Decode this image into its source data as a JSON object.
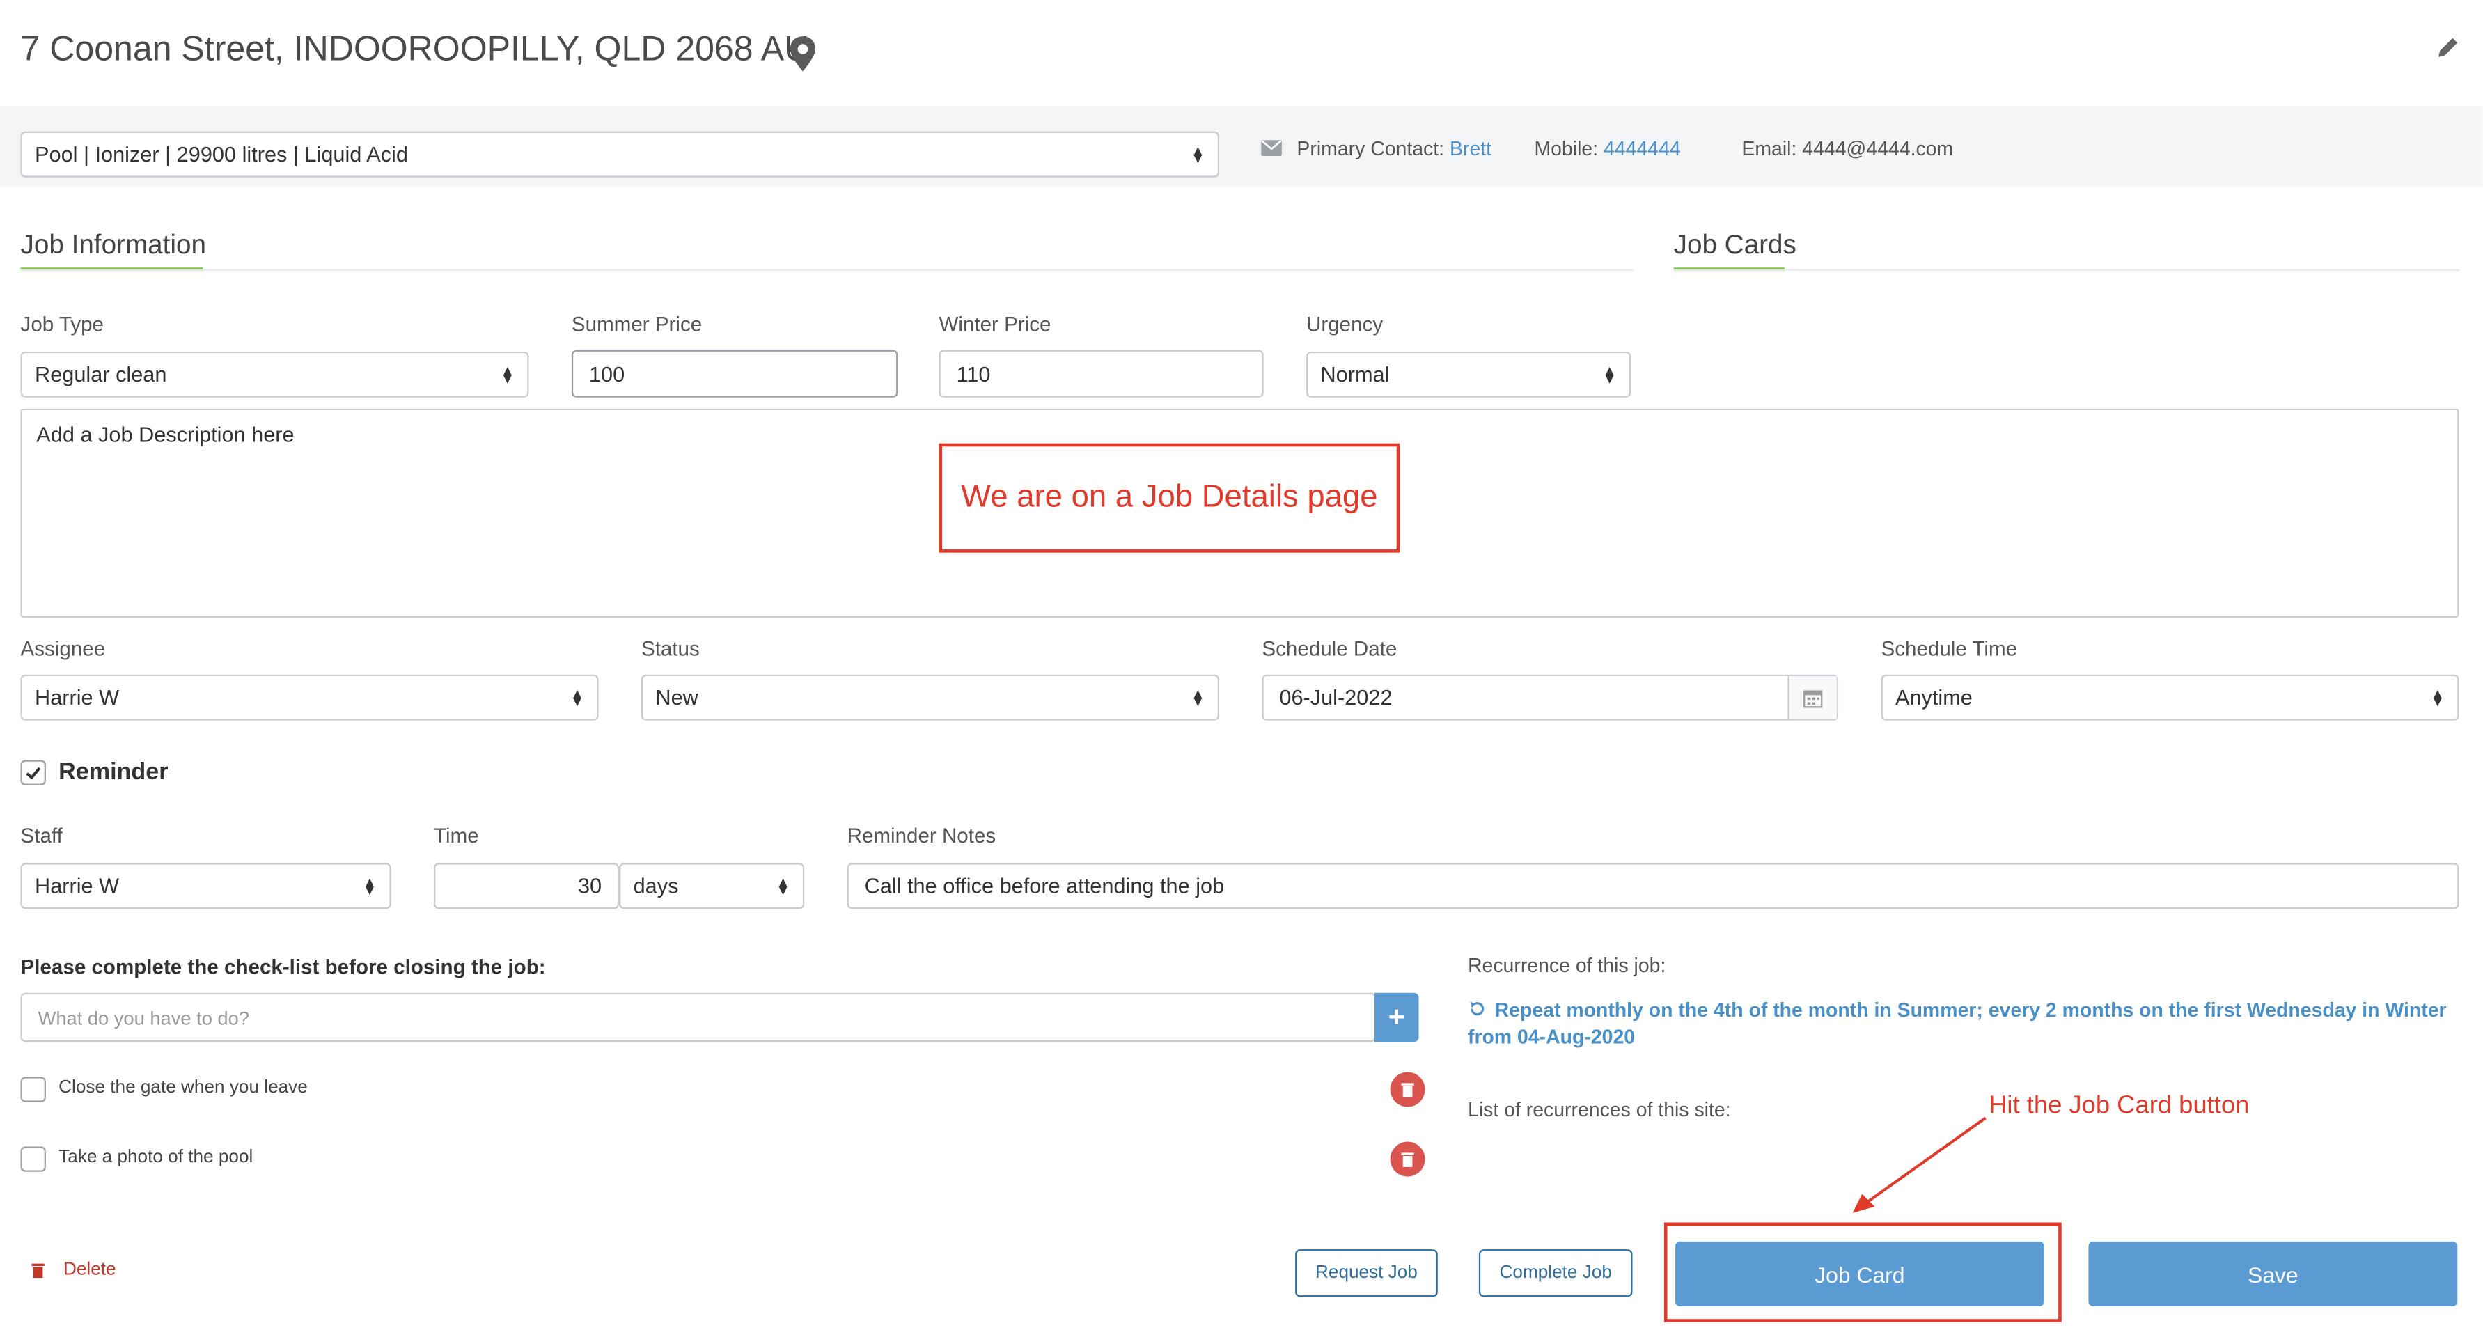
{
  "header": {
    "address": "7 Coonan Street, INDOOROOPILLY, QLD 2068 AU"
  },
  "contact_bar": {
    "pool_select": "Pool | Ionizer | 29900 litres | Liquid Acid",
    "primary_contact_label": "Primary Contact:",
    "primary_contact_value": "Brett",
    "mobile_label": "Mobile:",
    "mobile_value": "4444444",
    "email_label": "Email:",
    "email_value": "4444@4444.com"
  },
  "tabs": {
    "job_information": "Job Information",
    "job_cards": "Job Cards"
  },
  "job": {
    "job_type_label": "Job Type",
    "job_type_value": "Regular clean",
    "summer_price_label": "Summer Price",
    "summer_price_value": "100",
    "winter_price_label": "Winter Price",
    "winter_price_value": "110",
    "urgency_label": "Urgency",
    "urgency_value": "Normal",
    "description_placeholder": "Add a Job Description here",
    "assignee_label": "Assignee",
    "assignee_value": "Harrie W",
    "status_label": "Status",
    "status_value": "New",
    "schedule_date_label": "Schedule Date",
    "schedule_date_value": "06-Jul-2022",
    "schedule_time_label": "Schedule Time",
    "schedule_time_value": "Anytime"
  },
  "reminder": {
    "label": "Reminder",
    "checked": true,
    "staff_label": "Staff",
    "staff_value": "Harrie W",
    "time_label": "Time",
    "time_value": "30",
    "time_unit": "days",
    "notes_label": "Reminder Notes",
    "notes_value": "Call the office before attending the job"
  },
  "checklist": {
    "heading": "Please complete the check-list before closing the job:",
    "placeholder": "What do you have to do?",
    "add_symbol": "+",
    "items": [
      {
        "label": "Close the gate when you leave",
        "checked": false
      },
      {
        "label": "Take a photo of the pool",
        "checked": false
      }
    ]
  },
  "recurrence": {
    "heading": "Recurrence of this job:",
    "text": "Repeat monthly on the 4th of the month in Summer; every 2 months on the first Wednesday in Winter from 04-Aug-2020",
    "list_heading": "List of recurrences of this site:"
  },
  "actions": {
    "delete": "Delete",
    "request_job": "Request Job",
    "complete_job": "Complete Job",
    "job_card": "Job Card",
    "save": "Save"
  },
  "annotations": {
    "page_note": "We are on a Job Details page",
    "button_note": "Hit the Job Card button"
  },
  "colors": {
    "accent_green": "#7bc043",
    "link_blue": "#4a90c8",
    "primary_button": "#5b9bd1",
    "danger_red": "#d9534f",
    "annotation_red": "#e03a2b"
  },
  "icons": [
    "map-pin-icon",
    "pencil-icon",
    "envelope-icon",
    "calendar-icon",
    "plus-icon",
    "trash-icon",
    "refresh-icon",
    "check-icon",
    "select-arrows-icon"
  ]
}
